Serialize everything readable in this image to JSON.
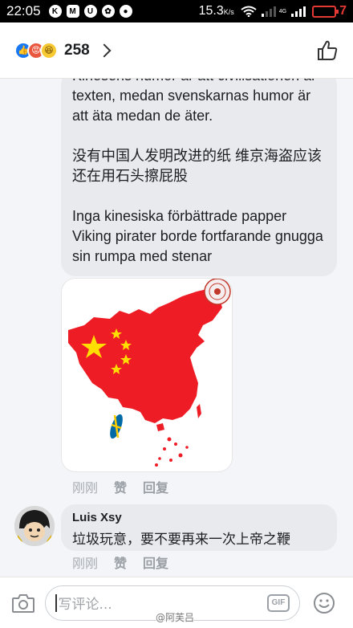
{
  "statusbar": {
    "time": "22:05",
    "notif_icons": [
      "K",
      "M",
      "U",
      "✿",
      "●"
    ],
    "speed_value": "15.3",
    "speed_unit": "K/s",
    "network_label": "4G",
    "battery_level": "7",
    "battery_color": "#e53935"
  },
  "header": {
    "reaction_count": "258",
    "reaction_types": [
      "like-icon",
      "angry-icon",
      "haha-icon"
    ]
  },
  "post": {
    "line_swedish_1": "Kinesens humor är att civilisationen är texten, medan svenskarnas humor är att äta medan de äter.",
    "line_chinese": "没有中国人发明改进的纸 维京海盗应该还在用石头擦屁股",
    "line_swedish_2": "Inga kinesiska förbättrade papper Viking pirater borde fortfarande gnugga sin rumpa med stenar",
    "actions": {
      "time": "刚刚",
      "like": "赞",
      "reply": "回复"
    }
  },
  "reply_comment": {
    "author": "Luis Xsy",
    "text": "垃圾玩意，要不要再来一次上帝之鞭",
    "actions": {
      "time": "刚刚",
      "like": "赞",
      "reply": "回复"
    }
  },
  "composer": {
    "placeholder": "写评论...",
    "gif_label": "GIF"
  },
  "watermark": "@阿芙吕",
  "colors": {
    "accent_blue": "#1877f2",
    "bubble_bg": "#e8eaee",
    "map_red": "#ee1c25",
    "star_yellow": "#ffde00"
  }
}
